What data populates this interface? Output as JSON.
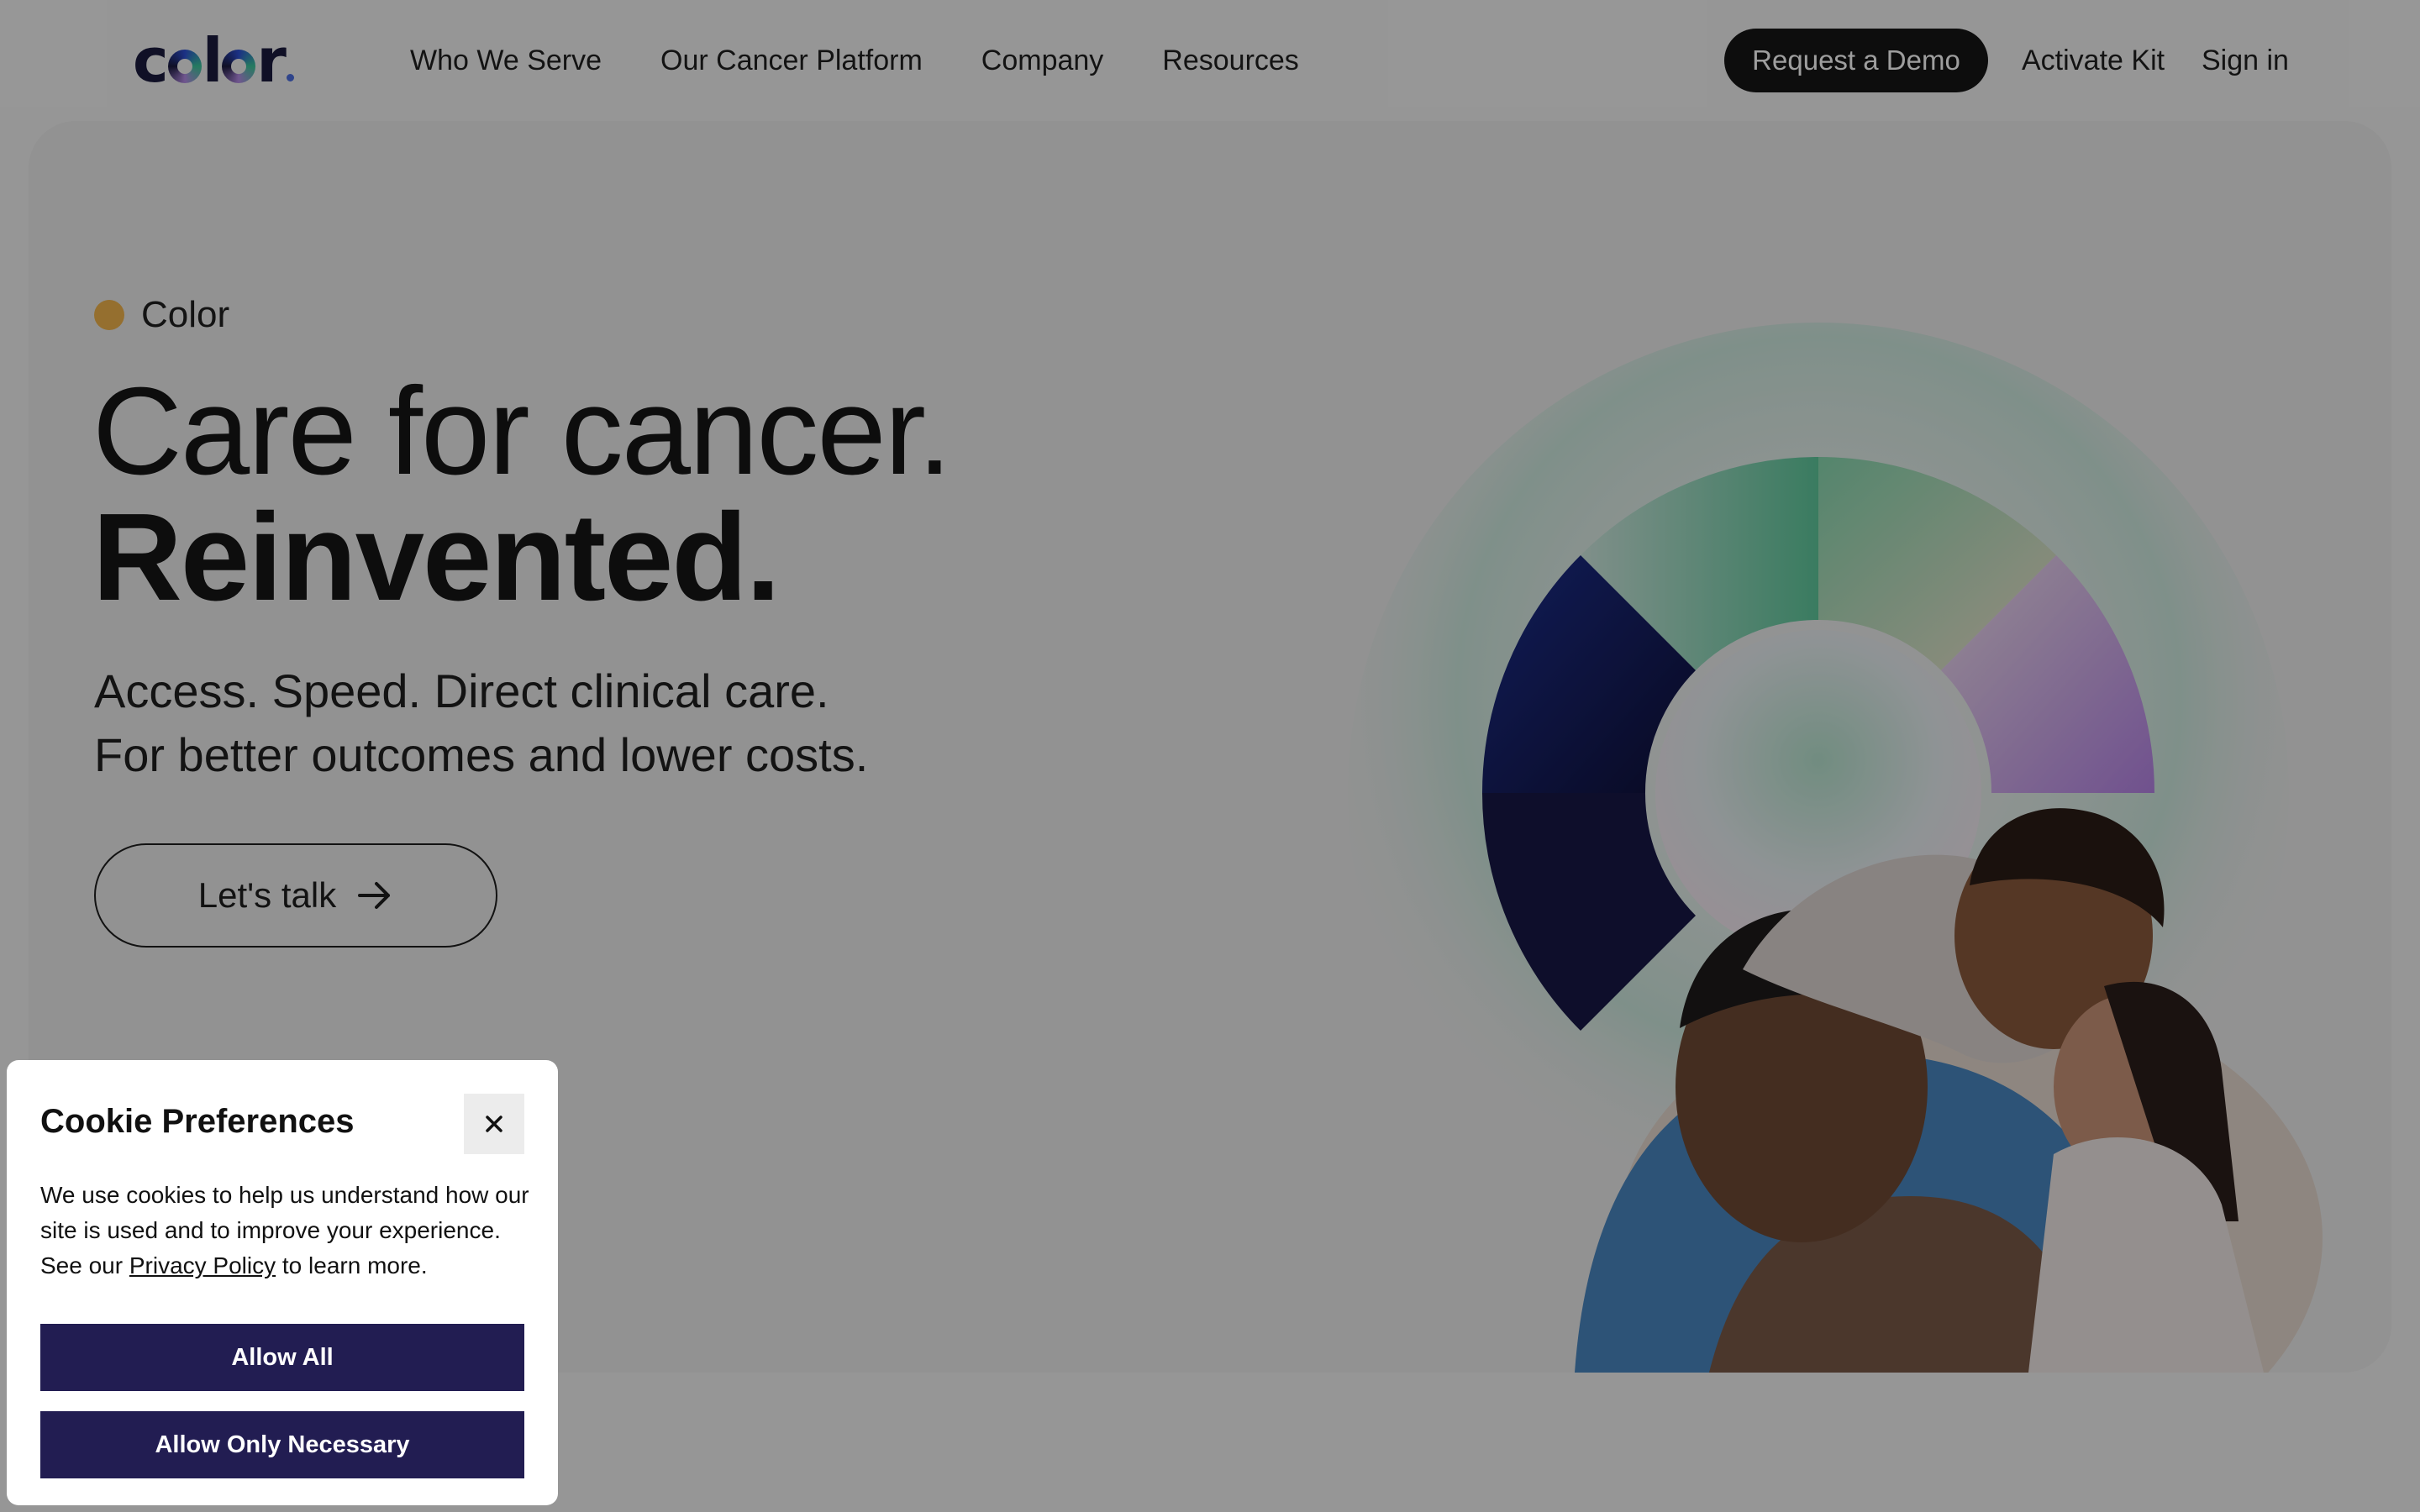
{
  "nav": {
    "logo": "color",
    "links": [
      "Who We Serve",
      "Our Cancer Platform",
      "Company",
      "Resources"
    ],
    "demo_button": "Request a Demo",
    "activate_kit": "Activate Kit",
    "sign_in": "Sign in"
  },
  "hero": {
    "eyebrow": "Color",
    "headline_line1": "Care for cancer.",
    "headline_line2": "Reinvented.",
    "subhead_line1": "Access. Speed. Direct clinical care.",
    "subhead_line2": "For better outcomes and lower costs.",
    "cta_label": "Let's talk"
  },
  "cookie": {
    "title": "Cookie Preferences",
    "text_before": "We use cookies to help us understand how our site is used and to improve your experience. See our ",
    "privacy_link": "Privacy Policy",
    "text_after": " to learn more.",
    "allow_all": "Allow All",
    "allow_necessary": "Allow Only Necessary"
  },
  "colors": {
    "brand_navy": "#221d52",
    "eyebrow_dot": "#f0b44c",
    "demo_button_bg": "#151515"
  },
  "icons": {
    "cta": "arrow-right-icon",
    "close": "close-icon"
  }
}
